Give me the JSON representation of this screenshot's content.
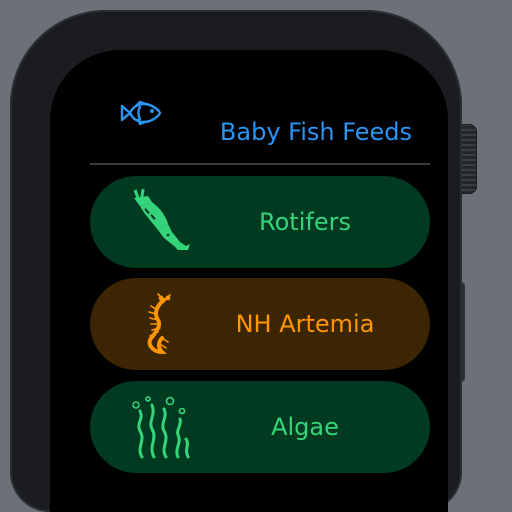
{
  "app": {
    "title": "Baby Fish Feeds",
    "icon": "fish-icon"
  },
  "feeds": [
    {
      "label": "Rotifers",
      "icon": "rotifer-icon",
      "color": "#35d47a",
      "background": "#003a21"
    },
    {
      "label": "NH Artemia",
      "icon": "artemia-icon",
      "color": "#ff9500",
      "background": "#3c2503"
    },
    {
      "label": "Algae",
      "icon": "algae-icon",
      "color": "#35d47a",
      "background": "#003a21"
    }
  ],
  "colors": {
    "accent": "#2b94f5",
    "screen": "#000000",
    "backdrop": "#6b7079"
  }
}
